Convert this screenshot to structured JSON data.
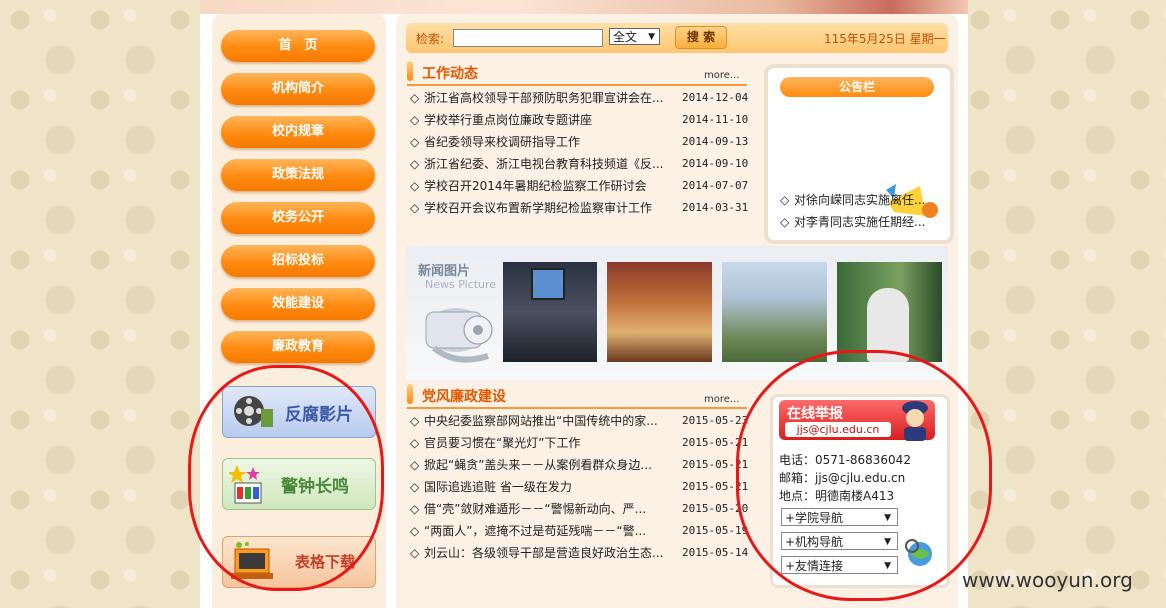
{
  "nav": [
    "首　页",
    "机构简介",
    "校内规章",
    "政策法规",
    "校务公开",
    "招标投标",
    "效能建设",
    "廉政教育"
  ],
  "banners": {
    "film": "反腐影片",
    "alarm": "警钟长鸣",
    "download": "表格下载"
  },
  "search": {
    "label": "检索:",
    "value": "",
    "scope": "全文",
    "button": "搜 索",
    "date": "115年5月25日 星期一"
  },
  "work_news": {
    "title": "工作动态",
    "more": "more...",
    "items": [
      {
        "title": "浙江省高校领导干部预防职务犯罪宣讲会在...",
        "date": "2014-12-04"
      },
      {
        "title": "学校举行重点岗位廉政专题讲座",
        "date": "2014-11-10"
      },
      {
        "title": "省纪委领导来校调研指导工作",
        "date": "2014-09-13"
      },
      {
        "title": "浙江省纪委、浙江电视台教育科技频道《反...",
        "date": "2014-09-10"
      },
      {
        "title": "学校召开2014年暑期纪检监察工作研讨会",
        "date": "2014-07-07"
      },
      {
        "title": "学校召开会议布置新学期纪检监察审计工作",
        "date": "2014-03-31"
      }
    ]
  },
  "bulletin": {
    "title": "公告栏",
    "items": [
      "对徐向嵘同志实施离任...",
      "对李青同志实施任期经..."
    ]
  },
  "news_pictures": {
    "title": "新闻图片",
    "subtitle": "News Picture"
  },
  "integrity": {
    "title": "党风廉政建设",
    "more": "more...",
    "items": [
      {
        "title": "中央纪委监察部网站推出“中国传统中的家...",
        "date": "2015-05-23"
      },
      {
        "title": "官员要习惯在“聚光灯”下工作",
        "date": "2015-05-21"
      },
      {
        "title": "掀起“蝇贪”盖头来－－从案例看群众身边...",
        "date": "2015-05-21"
      },
      {
        "title": "国际追逃追赃 省一级在发力",
        "date": "2015-05-21"
      },
      {
        "title": "借“壳”敛财难遁形－－“警惕新动向、严...",
        "date": "2015-05-20"
      },
      {
        "title": "“两面人”，遮掩不过是苟延残喘－－“警...",
        "date": "2015-05-19"
      },
      {
        "title": "刘云山：各级领导干部是营造良好政治生态...",
        "date": "2015-05-14"
      }
    ]
  },
  "report": {
    "title": "在线举报",
    "email_badge": "jjs@cjlu.edu.cn",
    "phone": "电话：0571-86836042",
    "mail": "邮箱：jjs@cjlu.edu.cn",
    "address": "地点：明德南楼A413",
    "selects": [
      "+学院导航",
      "+机构导航",
      "+友情连接"
    ]
  },
  "watermark": "www.wooyun.org",
  "colors": {
    "accent": "#ff8a10",
    "annotation": "#e81818",
    "title": "#e05a00"
  }
}
